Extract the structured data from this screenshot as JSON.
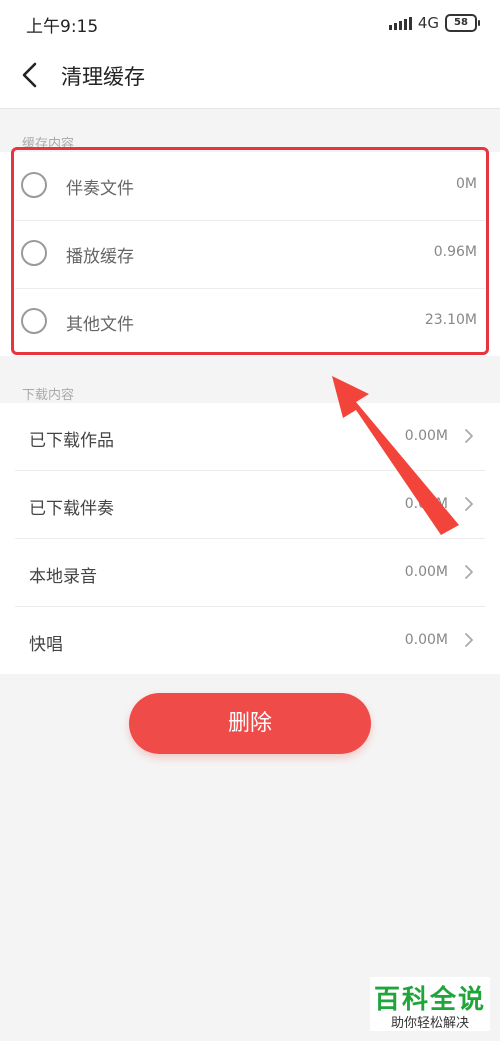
{
  "status": {
    "time": "上午9:15",
    "network": "4G",
    "battery": "58"
  },
  "nav": {
    "title": "清理缓存",
    "back_icon": "chevron-left-icon"
  },
  "cache_section": {
    "label": "缓存内容",
    "items": [
      {
        "label": "伴奏文件",
        "size": "0M"
      },
      {
        "label": "播放缓存",
        "size": "0.96M"
      },
      {
        "label": "其他文件",
        "size": "23.10M"
      }
    ]
  },
  "download_section": {
    "label": "下载内容",
    "items": [
      {
        "label": "已下载作品",
        "size": "0.00M"
      },
      {
        "label": "已下载伴奏",
        "size": "0.00M"
      },
      {
        "label": "本地录音",
        "size": "0.00M"
      },
      {
        "label": "快唱",
        "size": "0.00M"
      }
    ]
  },
  "actions": {
    "delete_label": "删除"
  },
  "annotation": {
    "highlight_color": "#e8343c",
    "arrow_icon": "pointer-arrow-icon"
  },
  "watermark": {
    "title": "百科全说",
    "subtitle": "助你轻松解决"
  },
  "colors": {
    "accent": "#ee4b49",
    "brand_green": "#1fa539"
  }
}
